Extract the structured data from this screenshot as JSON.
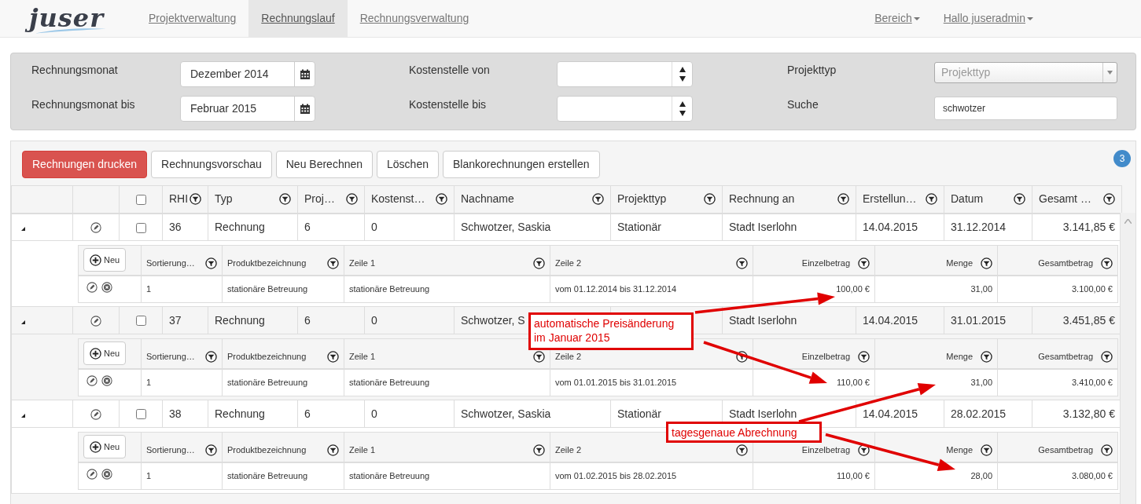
{
  "navbar": {
    "logo": "juser",
    "items": [
      {
        "label": "Projektverwaltung",
        "selected": false
      },
      {
        "label": "Rechnungslauf",
        "selected": true
      },
      {
        "label": "Rechnungsverwaltung",
        "selected": false
      }
    ],
    "menus": [
      {
        "label": "Bereich"
      },
      {
        "label": "Hallo juseradmin"
      }
    ]
  },
  "filters": [
    {
      "label": "Rechnungsmonat",
      "kind": "date",
      "value": "Dezember 2014"
    },
    {
      "label": "Kostenstelle von",
      "kind": "spinner"
    },
    {
      "label": "Projekttyp",
      "kind": "select",
      "placeholder": "Projekttyp"
    },
    {
      "label": "Rechnungsmonat bis",
      "kind": "date",
      "value": "Februar 2015"
    },
    {
      "label": "Kostenstelle bis",
      "kind": "spinner"
    },
    {
      "label": "Suche",
      "kind": "text",
      "value": "schwotzer"
    }
  ],
  "toolbar": {
    "buttons": [
      {
        "label": "Rechnungen drucken",
        "kind": "primary"
      },
      {
        "label": "Rechnungsvorschau",
        "kind": "default"
      },
      {
        "label": "Neu Berechnen",
        "kind": "default"
      },
      {
        "label": "Löschen",
        "kind": "default"
      },
      {
        "label": "Blankorechnungen erstellen",
        "kind": "default"
      }
    ],
    "count": "3"
  },
  "table": {
    "select_all": {
      "checked": false
    },
    "columns": [
      {
        "label": "RHI"
      },
      {
        "label": "Typ"
      },
      {
        "label": "Proj…"
      },
      {
        "label": "Kostenst…"
      },
      {
        "label": "Nachname"
      },
      {
        "label": "Projekttyp"
      },
      {
        "label": "Rechnung an"
      },
      {
        "label": "Erstellun…"
      },
      {
        "label": "Datum"
      },
      {
        "label": "Gesamt …"
      }
    ],
    "rows": [
      {
        "expanded": true,
        "checked": false,
        "cells": [
          "36",
          "Rechnung",
          "6",
          "0",
          "Schwotzer, Saskia",
          "Stationär",
          "Stadt Iserlohn",
          "14.04.2015",
          "31.12.2014",
          "3.141,85 €"
        ],
        "items": {
          "new_button": "Neu",
          "columns": [
            {
              "label": "Sortierung…",
              "numeric": false
            },
            {
              "label": "Produktbezeichnung",
              "numeric": false
            },
            {
              "label": "Zeile 1",
              "numeric": false
            },
            {
              "label": "Zeile 2",
              "numeric": false
            },
            {
              "label": "Einzelbetrag",
              "numeric": true
            },
            {
              "label": "Menge",
              "numeric": true
            },
            {
              "label": "Gesamtbetrag",
              "numeric": true
            }
          ],
          "rows": [
            {
              "cells": [
                "1",
                "stationäre Betreuung",
                "stationäre Betreuung",
                "vom 01.12.2014 bis 31.12.2014",
                "100,00 €",
                "31,00",
                "3.100,00 €"
              ]
            }
          ]
        }
      },
      {
        "expanded": true,
        "checked": false,
        "cells": [
          "37",
          "Rechnung",
          "6",
          "0",
          "Schwotzer, S",
          "",
          "Stadt Iserlohn",
          "14.04.2015",
          "31.01.2015",
          "3.451,85 €"
        ],
        "items": {
          "new_button": "Neu",
          "columns": [
            {
              "label": "Sortierung…",
              "numeric": false
            },
            {
              "label": "Produktbezeichnung",
              "numeric": false
            },
            {
              "label": "Zeile 1",
              "numeric": false
            },
            {
              "label": "Zeile 2",
              "numeric": false
            },
            {
              "label": "Einzelbetrag",
              "numeric": true
            },
            {
              "label": "Menge",
              "numeric": true
            },
            {
              "label": "Gesamtbetrag",
              "numeric": true
            }
          ],
          "rows": [
            {
              "cells": [
                "1",
                "stationäre Betreuung",
                "stationäre Betreuung",
                "vom 01.01.2015 bis 31.01.2015",
                "110,00 €",
                "31,00",
                "3.410,00 €"
              ]
            }
          ]
        }
      },
      {
        "expanded": true,
        "checked": false,
        "cells": [
          "38",
          "Rechnung",
          "6",
          "0",
          "Schwotzer, Saskia",
          "Stationär",
          "Stadt Iserlohn",
          "14.04.2015",
          "28.02.2015",
          "3.132,80 €"
        ],
        "items": {
          "new_button": "Neu",
          "columns": [
            {
              "label": "Sortierung…",
              "numeric": false
            },
            {
              "label": "Produktbezeichnung",
              "numeric": false
            },
            {
              "label": "Zeile 1",
              "numeric": false
            },
            {
              "label": "Zeile 2",
              "numeric": false
            },
            {
              "label": "Einzelbetrag",
              "numeric": true
            },
            {
              "label": "Menge",
              "numeric": true
            },
            {
              "label": "Gesamtbetrag",
              "numeric": true
            }
          ],
          "rows": [
            {
              "cells": [
                "1",
                "stationäre Betreuung",
                "stationäre Betreuung",
                "vom 01.02.2015 bis 28.02.2015",
                "110,00 €",
                "28,00",
                "3.080,00 €"
              ]
            }
          ]
        }
      }
    ]
  },
  "annotations": [
    {
      "text": "automatische Preisänderung im Januar 2015"
    },
    {
      "text": "tagesgenaue Abrechnung"
    }
  ]
}
